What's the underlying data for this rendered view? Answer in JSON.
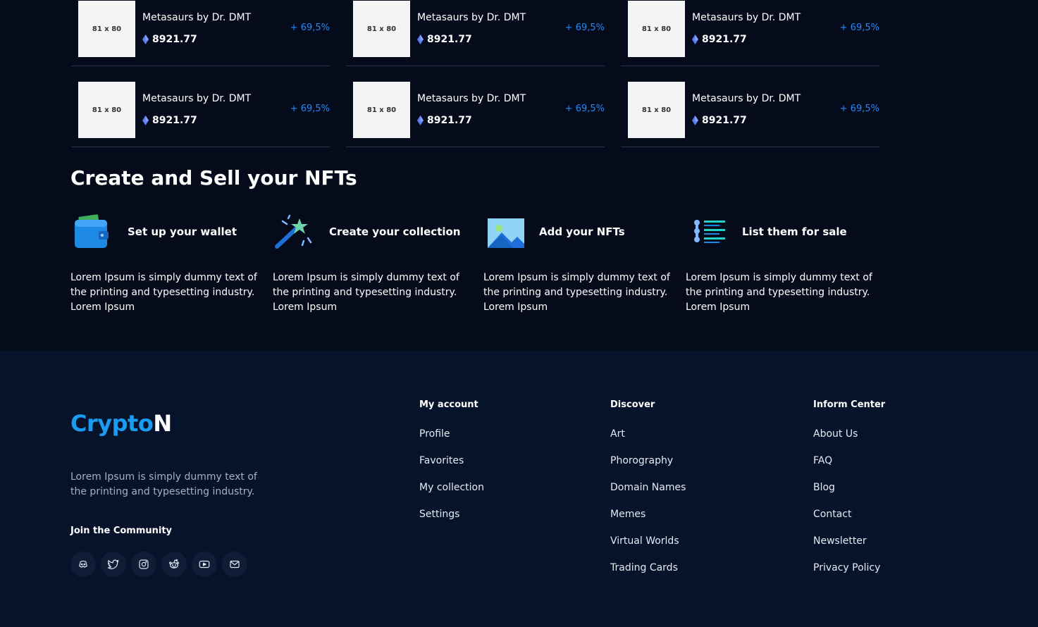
{
  "nft_grid": {
    "items": [
      {
        "thumb": "81 x 80",
        "name": "Metasaurs by Dr. DMT",
        "price": "8921.77",
        "change": "+ 69,5%"
      },
      {
        "thumb": "81 x 80",
        "name": "Metasaurs by Dr. DMT",
        "price": "8921.77",
        "change": "+ 69,5%"
      },
      {
        "thumb": "81 x 80",
        "name": "Metasaurs by Dr. DMT",
        "price": "8921.77",
        "change": "+ 69,5%"
      },
      {
        "thumb": "81 x 80",
        "name": "Metasaurs by Dr. DMT",
        "price": "8921.77",
        "change": "+ 69,5%"
      },
      {
        "thumb": "81 x 80",
        "name": "Metasaurs by Dr. DMT",
        "price": "8921.77",
        "change": "+ 69,5%"
      },
      {
        "thumb": "81 x 80",
        "name": "Metasaurs by Dr. DMT",
        "price": "8921.77",
        "change": "+ 69,5%"
      }
    ],
    "change_color": "#1f8bff"
  },
  "create_section": {
    "title": "Create and Sell your NFTs",
    "steps": [
      {
        "icon": "wallet-icon",
        "title": "Set up your wallet",
        "desc": "Lorem Ipsum is simply dummy text of the printing and typesetting industry. Lorem Ipsum"
      },
      {
        "icon": "magic-wand-icon",
        "title": "Create your collection",
        "desc": "Lorem Ipsum is simply dummy text of the printing and typesetting industry. Lorem Ipsum"
      },
      {
        "icon": "image-icon",
        "title": "Add your NFTs",
        "desc": "Lorem Ipsum is simply dummy text of the printing and typesetting industry. Lorem Ipsum"
      },
      {
        "icon": "list-icon",
        "title": "List them for sale",
        "desc": "Lorem Ipsum is simply dummy text of the printing and typesetting industry. Lorem Ipsum"
      }
    ]
  },
  "footer": {
    "logo_part1": "Crypto",
    "logo_part2": "N",
    "brand_color": "#1a9cf0",
    "description": "Lorem Ipsum is simply dummy text of the printing and typesetting industry.",
    "join_title": "Join the Community",
    "socials": [
      "discord-icon",
      "twitter-icon",
      "instagram-icon",
      "reddit-icon",
      "youtube-icon",
      "mail-icon"
    ],
    "columns": [
      {
        "title": "My account",
        "links": [
          "Profile",
          "Favorites",
          "My collection",
          "Settings"
        ]
      },
      {
        "title": "Discover",
        "links": [
          "Art",
          "Phorography",
          "Domain Names",
          "Memes",
          "Virtual Worlds",
          "Trading Cards"
        ]
      },
      {
        "title": "Inform Center",
        "links": [
          "About Us",
          "FAQ",
          "Blog",
          "Contact",
          "Newsletter",
          "Privacy Policy"
        ]
      }
    ]
  }
}
